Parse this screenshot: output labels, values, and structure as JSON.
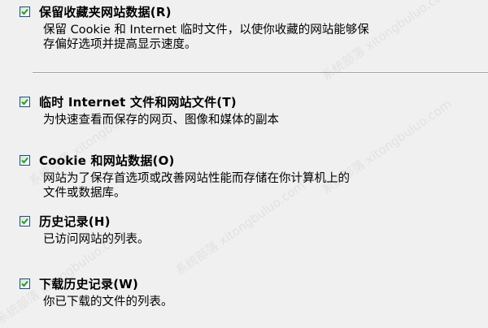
{
  "options": [
    {
      "title": "保留收藏夹网站数据(R)",
      "description": "保留 Cookie 和 Internet 临时文件，以使你收藏的网站能够保\n存偏好选项并提高显示速度。",
      "checked": true
    },
    {
      "title": "临时 Internet 文件和网站文件(T)",
      "description": "为快速查看而保存的网页、图像和媒体的副本",
      "checked": true
    },
    {
      "title": "Cookie 和网站数据(O)",
      "description": "网站为了保存首选项或改善网站性能而存储在你计算机上的\n文件或数据库。",
      "checked": true
    },
    {
      "title": "历史记录(H)",
      "description": "已访问网站的列表。",
      "checked": true
    },
    {
      "title": "下载历史记录(W)",
      "description": "你已下载的文件的列表。",
      "checked": true
    }
  ],
  "watermark": "系统部落 xitongbuluo.com",
  "colors": {
    "background": "#f0f0f0",
    "checkbox_border": "#1c5180",
    "checkmark": "#21a121",
    "divider": "#a0a0a0"
  }
}
